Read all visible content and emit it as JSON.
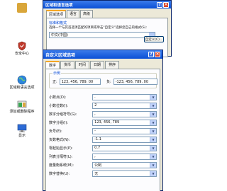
{
  "control_panel": {
    "items": [
      {
        "label": "",
        "icon": "folder-icon",
        "color": "#d9a63a"
      },
      {
        "label": "安全中心",
        "icon": "shield-icon",
        "color": "#c0392b"
      },
      {
        "label": "区域和语言选项",
        "icon": "globe-icon",
        "color": "#2e86de"
      },
      {
        "label": "添加或删除程序",
        "icon": "add-remove-programs-icon",
        "color": "#3aa655"
      },
      {
        "label": "显示",
        "icon": "display-icon",
        "color": "#2d6bd6"
      }
    ]
  },
  "back_window": {
    "title": "区域和语言选项",
    "tabs": [
      "区域选项",
      "语言",
      "高级"
    ],
    "active_tab": 0,
    "group_title": "标准和格式",
    "description": "选择一个与其首选项匹配的项目或单击\"自定义\"选择您自己的格式(S):",
    "selected_locale": "中文(中国)",
    "customize_button": "自定义(C)..."
  },
  "front_window": {
    "title": "自定义区域选项",
    "tabs": [
      "数字",
      "货币",
      "时间",
      "日期",
      "排序"
    ],
    "active_tab": 0,
    "example_title": "示例",
    "positive_label": "正:",
    "positive_value": "123, 456, 789. 00",
    "negative_label": "负:",
    "negative_value": "-123, 456, 789. 00",
    "settings": [
      {
        "label": "小数点(D):",
        "value": "."
      },
      {
        "label": "小数位数(I):",
        "value": "2"
      },
      {
        "label": "数字分组符号(G):",
        "value": ","
      },
      {
        "label": "数字分组(I):",
        "value": "123, 456, 789"
      },
      {
        "label": "负号(E):",
        "value": "-"
      },
      {
        "label": "负数格式(N):",
        "value": "-1.1"
      },
      {
        "label": "零起始显示(P):",
        "value": "0.7"
      },
      {
        "label": "列表分隔符(L):",
        "value": ","
      },
      {
        "label": "度量衡系统(M):",
        "value": "公制"
      },
      {
        "label": "数字替换(U):",
        "value": "无"
      }
    ]
  }
}
